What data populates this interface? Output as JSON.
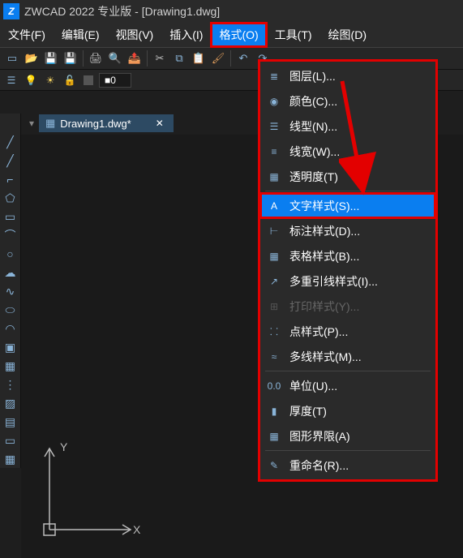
{
  "titlebar": {
    "app_name": "ZWCAD 2022 专业版",
    "doc_title": "[Drawing1.dwg]"
  },
  "menubar": {
    "items": [
      {
        "label": "文件(F)"
      },
      {
        "label": "编辑(E)"
      },
      {
        "label": "视图(V)"
      },
      {
        "label": "插入(I)"
      },
      {
        "label": "格式(O)",
        "active": true
      },
      {
        "label": "工具(T)"
      },
      {
        "label": "绘图(D)"
      }
    ]
  },
  "layer": {
    "current": "0"
  },
  "tab": {
    "label": "Drawing1.dwg*",
    "icon": "📄"
  },
  "dropdown": {
    "items": [
      {
        "icon": "layers",
        "label": "图层(L)..."
      },
      {
        "icon": "palette",
        "label": "颜色(C)..."
      },
      {
        "icon": "linetype",
        "label": "线型(N)..."
      },
      {
        "icon": "lineweight",
        "label": "线宽(W)..."
      },
      {
        "icon": "transparency",
        "label": "透明度(T)"
      },
      {
        "sep": true
      },
      {
        "icon": "text-style",
        "label": "文字样式(S)...",
        "highlighted": true
      },
      {
        "icon": "dim-style",
        "label": "标注样式(D)..."
      },
      {
        "icon": "table-style",
        "label": "表格样式(B)..."
      },
      {
        "icon": "mleader-style",
        "label": "多重引线样式(I)..."
      },
      {
        "icon": "print-style",
        "label": "打印样式(Y)...",
        "disabled": true
      },
      {
        "icon": "point-style",
        "label": "点样式(P)..."
      },
      {
        "icon": "mline-style",
        "label": "多线样式(M)..."
      },
      {
        "sep": true
      },
      {
        "icon": "units",
        "label": "单位(U)..."
      },
      {
        "icon": "thickness",
        "label": "厚度(T)"
      },
      {
        "icon": "limits",
        "label": "图形界限(A)"
      },
      {
        "sep": true
      },
      {
        "icon": "rename",
        "label": "重命名(R)..."
      }
    ]
  },
  "ucs": {
    "x": "X",
    "y": "Y"
  }
}
